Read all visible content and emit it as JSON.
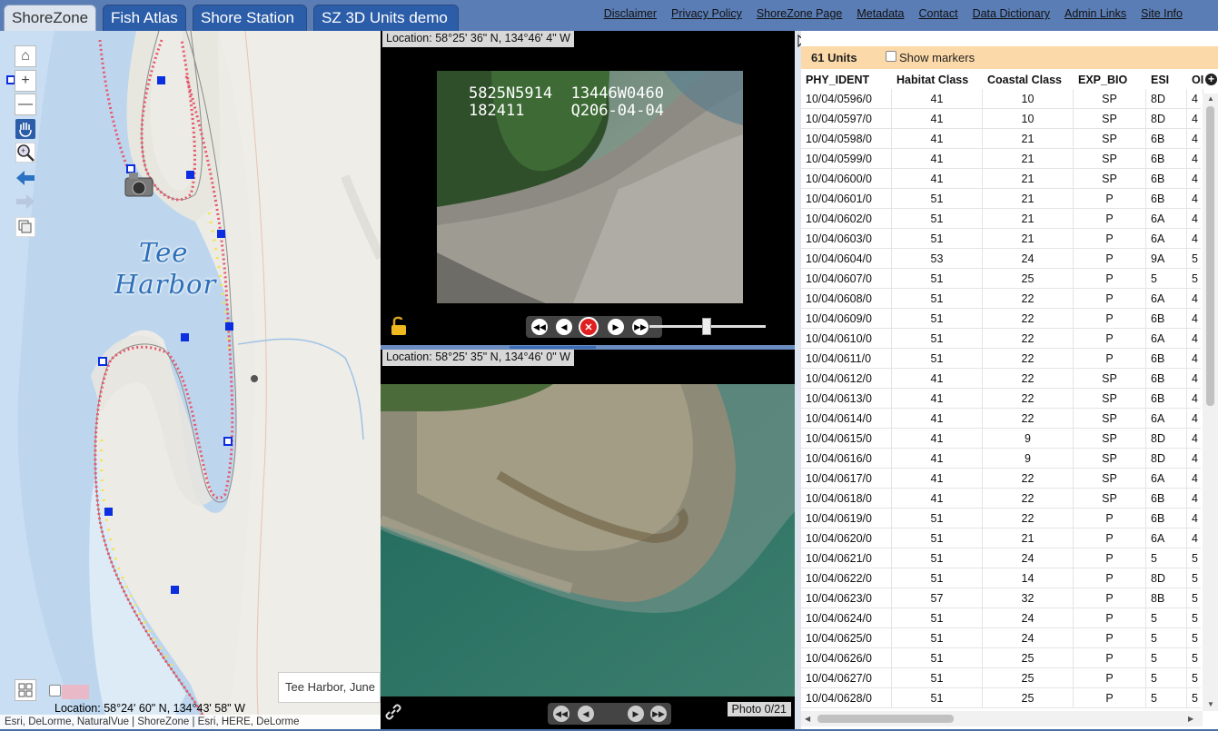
{
  "tabs": [
    "ShoreZone",
    "Fish Atlas",
    "Shore Station",
    "SZ 3D Units demo"
  ],
  "links": [
    "Disclaimer",
    "Privacy Policy",
    "ShoreZone Page",
    "Metadata",
    "Contact",
    "Data Dictionary",
    "Admin Links",
    "Site Info"
  ],
  "map": {
    "label_line1": "Tee",
    "label_line2": "Harbor",
    "popup_text": "Tee Harbor, June",
    "location": "Location: 58°24' 60\" N, 134°43' 58\" W",
    "attribution": "Esri, DeLorme, NaturalVue | ShoreZone | Esri, HERE, DeLorme",
    "icons": [
      "home-icon",
      "zoom-in-icon",
      "zoom-out-icon",
      "pan-hand-icon",
      "zoom-box-icon",
      "back-arrow-icon",
      "forward-arrow-icon",
      "layers-icon",
      "legend-icon"
    ]
  },
  "video": {
    "location": "Location: 58°25' 36\" N, 134°46' 4\" W",
    "overlay_line1": "5825N5914  13446W0460",
    "overlay_line2": "182411     Q206-04-04",
    "controls": [
      "rewind-fast",
      "step-back",
      "stop",
      "play",
      "fast-forward"
    ]
  },
  "photo": {
    "location": "Location: 58°25' 35\" N, 134°46' 0\" W",
    "counter": "Photo 0/21"
  },
  "table": {
    "units_count": "61 Units",
    "show_markers_label": "Show markers",
    "columns": [
      "PHY_IDENT",
      "Habitat Class",
      "Coastal Class",
      "EXP_BIO",
      "ESI",
      "OI"
    ],
    "rows": [
      [
        "10/04/0596/0",
        "41",
        "10",
        "SP",
        "8D",
        "4"
      ],
      [
        "10/04/0597/0",
        "41",
        "10",
        "SP",
        "8D",
        "4"
      ],
      [
        "10/04/0598/0",
        "41",
        "21",
        "SP",
        "6B",
        "4"
      ],
      [
        "10/04/0599/0",
        "41",
        "21",
        "SP",
        "6B",
        "4"
      ],
      [
        "10/04/0600/0",
        "41",
        "21",
        "SP",
        "6B",
        "4"
      ],
      [
        "10/04/0601/0",
        "51",
        "21",
        "P",
        "6B",
        "4"
      ],
      [
        "10/04/0602/0",
        "51",
        "21",
        "P",
        "6A",
        "4"
      ],
      [
        "10/04/0603/0",
        "51",
        "21",
        "P",
        "6A",
        "4"
      ],
      [
        "10/04/0604/0",
        "53",
        "24",
        "P",
        "9A",
        "5"
      ],
      [
        "10/04/0607/0",
        "51",
        "25",
        "P",
        "5",
        "5"
      ],
      [
        "10/04/0608/0",
        "51",
        "22",
        "P",
        "6A",
        "4"
      ],
      [
        "10/04/0609/0",
        "51",
        "22",
        "P",
        "6B",
        "4"
      ],
      [
        "10/04/0610/0",
        "51",
        "22",
        "P",
        "6A",
        "4"
      ],
      [
        "10/04/0611/0",
        "51",
        "22",
        "P",
        "6B",
        "4"
      ],
      [
        "10/04/0612/0",
        "41",
        "22",
        "SP",
        "6B",
        "4"
      ],
      [
        "10/04/0613/0",
        "41",
        "22",
        "SP",
        "6B",
        "4"
      ],
      [
        "10/04/0614/0",
        "41",
        "22",
        "SP",
        "6A",
        "4"
      ],
      [
        "10/04/0615/0",
        "41",
        "9",
        "SP",
        "8D",
        "4"
      ],
      [
        "10/04/0616/0",
        "41",
        "9",
        "SP",
        "8D",
        "4"
      ],
      [
        "10/04/0617/0",
        "41",
        "22",
        "SP",
        "6A",
        "4"
      ],
      [
        "10/04/0618/0",
        "41",
        "22",
        "SP",
        "6B",
        "4"
      ],
      [
        "10/04/0619/0",
        "51",
        "22",
        "P",
        "6B",
        "4"
      ],
      [
        "10/04/0620/0",
        "51",
        "21",
        "P",
        "6A",
        "4"
      ],
      [
        "10/04/0621/0",
        "51",
        "24",
        "P",
        "5",
        "5"
      ],
      [
        "10/04/0622/0",
        "51",
        "14",
        "P",
        "8D",
        "5"
      ],
      [
        "10/04/0623/0",
        "57",
        "32",
        "P",
        "8B",
        "5"
      ],
      [
        "10/04/0624/0",
        "51",
        "24",
        "P",
        "5",
        "5"
      ],
      [
        "10/04/0625/0",
        "51",
        "24",
        "P",
        "5",
        "5"
      ],
      [
        "10/04/0626/0",
        "51",
        "25",
        "P",
        "5",
        "5"
      ],
      [
        "10/04/0627/0",
        "51",
        "25",
        "P",
        "5",
        "5"
      ],
      [
        "10/04/0628/0",
        "51",
        "25",
        "P",
        "5",
        "5"
      ]
    ]
  },
  "colors": {
    "header_bg": "#5b7db5",
    "tab_bg": "#2c5da8",
    "units_bar": "#fcd9a8",
    "water": "#bcd6ee",
    "shore_dots_red": "#e8566a",
    "shore_dots_yellow": "#f4e542",
    "marker_blue": "#0a2ee0"
  }
}
